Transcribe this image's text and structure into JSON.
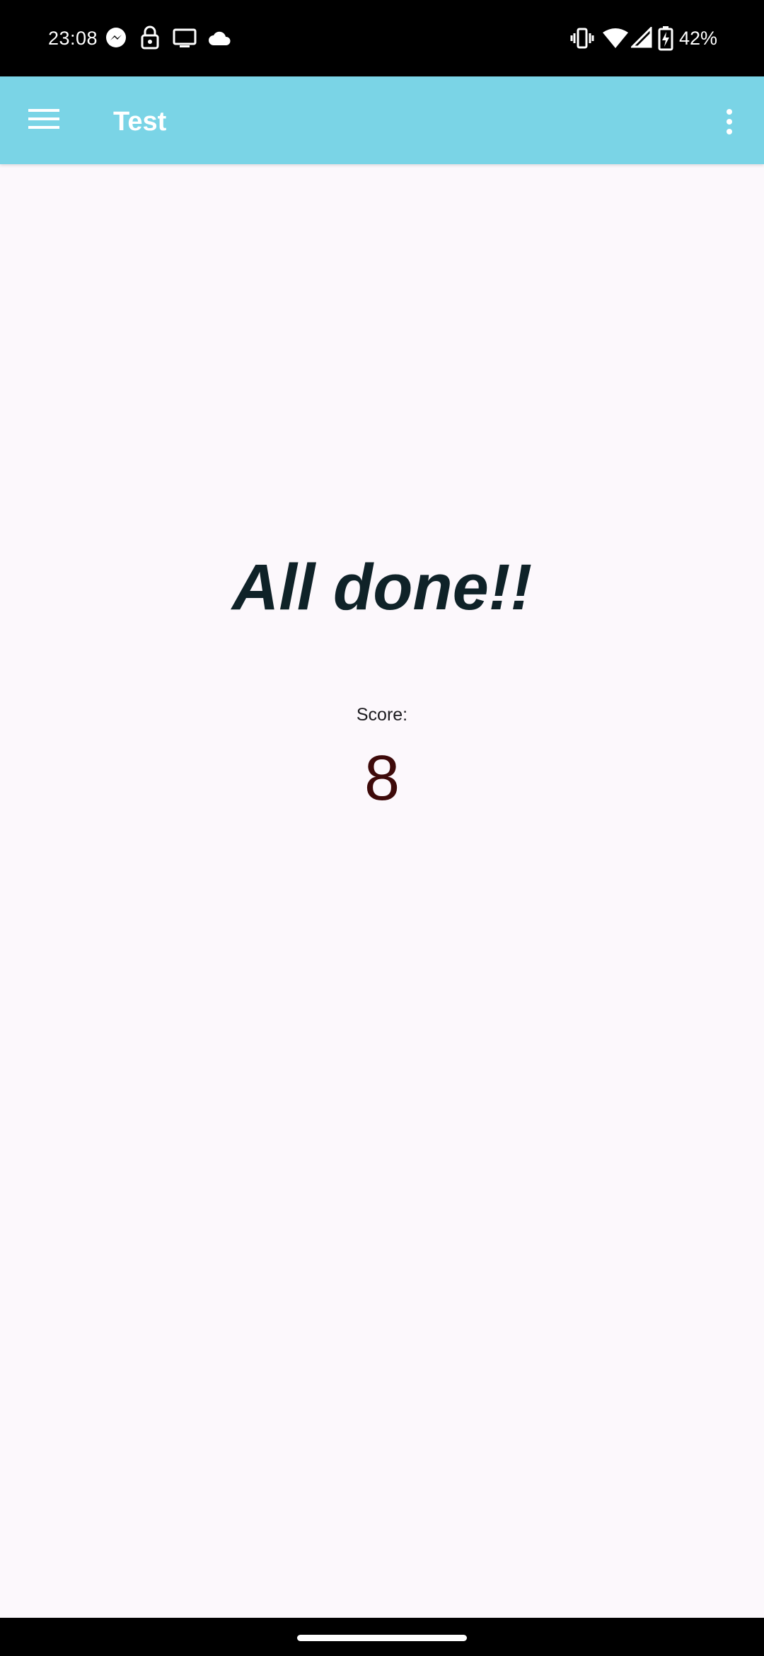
{
  "status_bar": {
    "time": "23:08",
    "battery_percent": "42%",
    "icons": [
      "messenger-icon",
      "lock-icon",
      "cast-icon",
      "cloud-icon",
      "vibrate-icon",
      "wifi-icon",
      "cell-signal-icon",
      "battery-charging-icon"
    ]
  },
  "app_bar": {
    "title": "Test",
    "background_color": "#7ad4e6",
    "menu_icon": "hamburger-menu-icon",
    "overflow_icon": "more-vert-icon"
  },
  "result": {
    "heading": "All done!!",
    "score_label": "Score:",
    "score_value": "8"
  }
}
